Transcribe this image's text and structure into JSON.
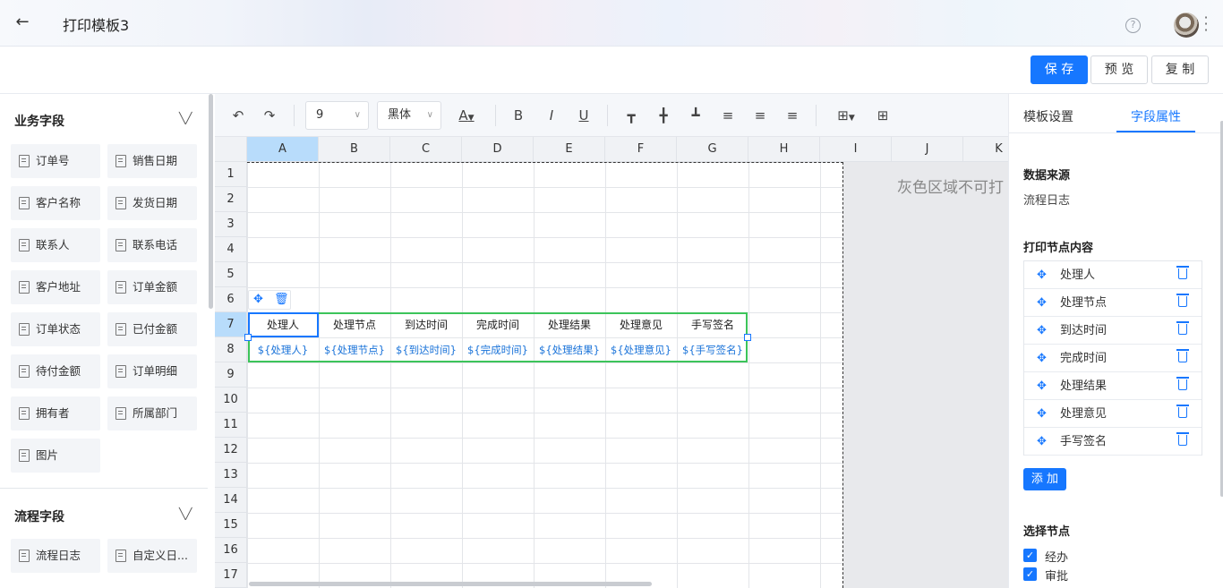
{
  "header": {
    "title": "打印模板3",
    "help_symbol": "?"
  },
  "actions": {
    "save": "保 存",
    "preview": "预 览",
    "copy": "复 制"
  },
  "left": {
    "business_title": "业务字段",
    "business_fields": [
      "订单号",
      "销售日期",
      "客户名称",
      "发货日期",
      "联系人",
      "联系电话",
      "客户地址",
      "订单金额",
      "订单状态",
      "已付金额",
      "待付金额",
      "订单明细",
      "拥有者",
      "所属部门",
      "图片"
    ],
    "process_title": "流程字段",
    "process_fields": [
      "流程日志",
      "自定义日..."
    ]
  },
  "toolbar": {
    "font_size": "9",
    "font_family": "黑体",
    "font_color_label": "A",
    "bold": "B",
    "italic": "I",
    "underline": "U"
  },
  "sheet": {
    "columns": [
      "A",
      "B",
      "C",
      "D",
      "E",
      "F",
      "G",
      "H",
      "I",
      "J",
      "K"
    ],
    "rows": [
      "1",
      "2",
      "3",
      "4",
      "5",
      "6",
      "7",
      "8",
      "9",
      "10",
      "11",
      "12",
      "13",
      "14",
      "15",
      "16",
      "17"
    ],
    "header_row": [
      "处理人",
      "处理节点",
      "到达时间",
      "完成时间",
      "处理结果",
      "处理意见",
      "手写签名"
    ],
    "placeholder_row": [
      "${处理人}",
      "${处理节点}",
      "${到达时间}",
      "${完成时间}",
      "${处理结果}",
      "${处理意见}",
      "${手写签名}"
    ],
    "gray_notice": "灰色区域不可打"
  },
  "right": {
    "tabs": [
      "模板设置",
      "字段属性"
    ],
    "data_source_label": "数据来源",
    "data_source_value": "流程日志",
    "print_content_label": "打印节点内容",
    "nodes": [
      "处理人",
      "处理节点",
      "到达时间",
      "完成时间",
      "处理结果",
      "处理意见",
      "手写签名"
    ],
    "add_button": "添 加",
    "select_node_label": "选择节点",
    "select_nodes": [
      "经办",
      "审批"
    ]
  },
  "colors": {
    "accent": "#1677ff",
    "selection_green": "#3cc45a"
  }
}
